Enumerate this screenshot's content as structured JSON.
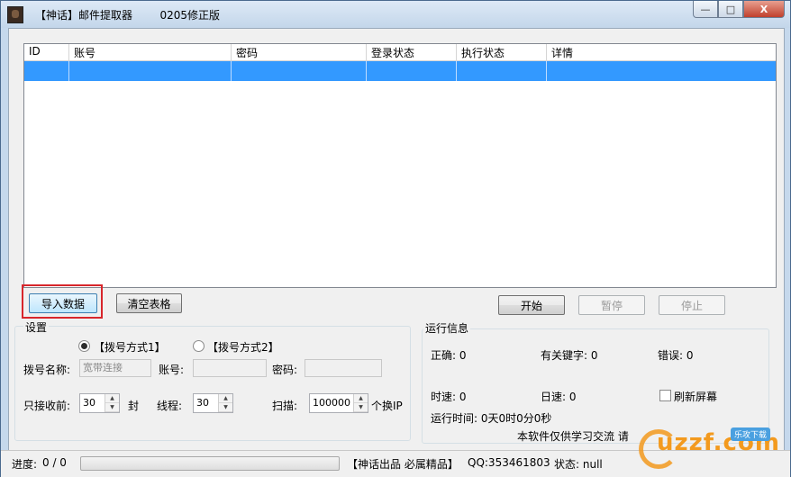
{
  "window": {
    "title": "【神话】邮件提取器        0205修正版",
    "controls": {
      "minimize": "—",
      "maximize": "□",
      "close": "X"
    }
  },
  "table": {
    "columns": [
      "ID",
      "账号",
      "密码",
      "登录状态",
      "执行状态",
      "详情"
    ],
    "rows": [
      [
        "",
        "",
        "",
        "",
        "",
        ""
      ]
    ]
  },
  "buttons": {
    "import": "导入数据",
    "clear": "清空表格",
    "start": "开始",
    "pause": "暂停",
    "stop": "停止"
  },
  "settings": {
    "group_title": "设置",
    "dial_mode_1": "【拨号方式1】",
    "dial_mode_2": "【拨号方式2】",
    "dial_name_label": "拨号名称:",
    "dial_name_value": "宽带连接",
    "account_label": "账号:",
    "account_value": "",
    "password_label": "密码:",
    "password_value": "",
    "receive_label": "只接收前:",
    "receive_value": "30",
    "receive_unit": "封",
    "threads_label": "线程:",
    "threads_value": "30",
    "scan_label": "扫描:",
    "scan_value": "100000",
    "scan_unit": "个换IP"
  },
  "runinfo": {
    "group_title": "运行信息",
    "correct": "正确: 0",
    "keyword": "有关键字: 0",
    "error": "错误: 0",
    "hour_speed": "时速: 0",
    "day_speed": "日速: 0",
    "refresh_label": "刷新屏幕",
    "run_time": "运行时间:  0天0时0分0秒",
    "notice": "本软件仅供学习交流 请"
  },
  "statusbar": {
    "progress_label": "进度:",
    "progress_text": "0  /  0",
    "brand": "【神话出品  必属精品】",
    "qq": "QQ:353461803",
    "state": "状态:  null"
  },
  "watermark": {
    "text": "uzzf.com",
    "tag": "乐攻下载"
  },
  "colors": {
    "selection": "#3399ff",
    "highlight_box": "#d8262b",
    "title_bg": "#c5d8ec"
  }
}
